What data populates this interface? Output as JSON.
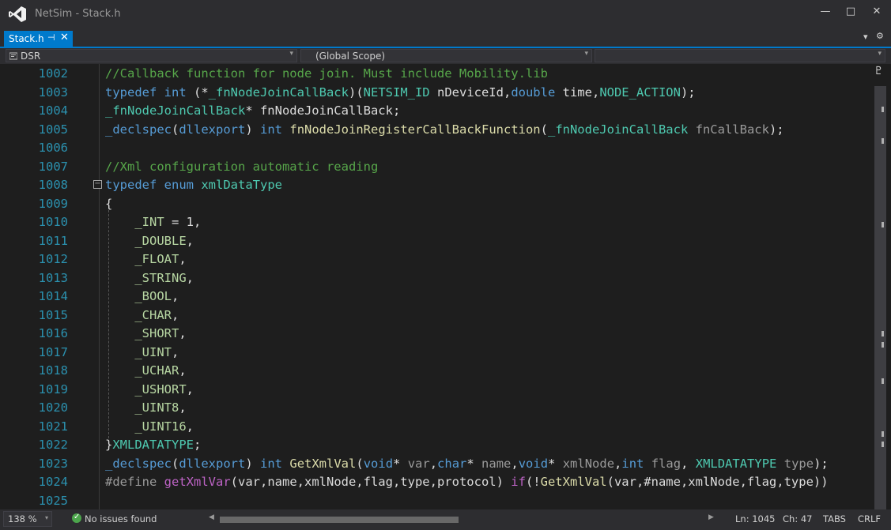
{
  "window": {
    "title": "NetSim - Stack.h",
    "minimize_glyph": "—",
    "maximize_glyph": "□",
    "close_glyph": "✕"
  },
  "tabs": [
    {
      "label": "Stack.h",
      "pin_glyph": "⊣",
      "close_glyph": "✕",
      "active": true
    }
  ],
  "tabrow_icons": {
    "dropdown_glyph": "▾",
    "settings_glyph": "⚙"
  },
  "navbar": {
    "project": "DSR",
    "scope": "(Global Scope)",
    "member": "",
    "arrow_glyph": "▾"
  },
  "editor": {
    "collapse_glyph": "−",
    "lines": [
      {
        "num": "1002",
        "tokens": [
          {
            "t": "//Callback function for node join. Must include Mobility.lib",
            "c": "comment"
          }
        ]
      },
      {
        "num": "1003",
        "tokens": [
          {
            "t": "typedef",
            "c": "kw"
          },
          {
            "t": " ",
            "c": "plain"
          },
          {
            "t": "int",
            "c": "kw"
          },
          {
            "t": " (*",
            "c": "plain"
          },
          {
            "t": "_fnNodeJoinCallBack",
            "c": "type"
          },
          {
            "t": ")(",
            "c": "plain"
          },
          {
            "t": "NETSIM_ID",
            "c": "type"
          },
          {
            "t": " nDeviceId,",
            "c": "plain"
          },
          {
            "t": "double",
            "c": "kw"
          },
          {
            "t": " time,",
            "c": "plain"
          },
          {
            "t": "NODE_ACTION",
            "c": "type"
          },
          {
            "t": ");",
            "c": "plain"
          }
        ]
      },
      {
        "num": "1004",
        "tokens": [
          {
            "t": "_fnNodeJoinCallBack",
            "c": "type"
          },
          {
            "t": "* fnNodeJoinCallBack;",
            "c": "plain"
          }
        ]
      },
      {
        "num": "1005",
        "tokens": [
          {
            "t": "_declspec",
            "c": "kw"
          },
          {
            "t": "(",
            "c": "plain"
          },
          {
            "t": "dllexport",
            "c": "kw"
          },
          {
            "t": ") ",
            "c": "plain"
          },
          {
            "t": "int",
            "c": "kw"
          },
          {
            "t": " ",
            "c": "plain"
          },
          {
            "t": "fnNodeJoinRegisterCallBackFunction",
            "c": "func"
          },
          {
            "t": "(",
            "c": "plain"
          },
          {
            "t": "_fnNodeJoinCallBack",
            "c": "type"
          },
          {
            "t": " ",
            "c": "plain"
          },
          {
            "t": "fnCallBack",
            "c": "param"
          },
          {
            "t": ");",
            "c": "plain"
          }
        ]
      },
      {
        "num": "1006",
        "tokens": []
      },
      {
        "num": "1007",
        "tokens": [
          {
            "t": "//Xml configuration automatic reading",
            "c": "comment"
          }
        ]
      },
      {
        "num": "1008",
        "tokens": [
          {
            "t": "typedef",
            "c": "kw"
          },
          {
            "t": " ",
            "c": "plain"
          },
          {
            "t": "enum",
            "c": "kw"
          },
          {
            "t": " ",
            "c": "plain"
          },
          {
            "t": "xmlDataType",
            "c": "type"
          }
        ]
      },
      {
        "num": "1009",
        "tokens": [
          {
            "t": "{",
            "c": "plain"
          }
        ]
      },
      {
        "num": "1010",
        "tokens": [
          {
            "t": "    ",
            "c": "plain"
          },
          {
            "t": "_INT",
            "c": "enum"
          },
          {
            "t": " = 1,",
            "c": "plain"
          }
        ]
      },
      {
        "num": "1011",
        "tokens": [
          {
            "t": "    ",
            "c": "plain"
          },
          {
            "t": "_DOUBLE",
            "c": "enum"
          },
          {
            "t": ",",
            "c": "plain"
          }
        ]
      },
      {
        "num": "1012",
        "tokens": [
          {
            "t": "    ",
            "c": "plain"
          },
          {
            "t": "_FLOAT",
            "c": "enum"
          },
          {
            "t": ",",
            "c": "plain"
          }
        ]
      },
      {
        "num": "1013",
        "tokens": [
          {
            "t": "    ",
            "c": "plain"
          },
          {
            "t": "_STRING",
            "c": "enum"
          },
          {
            "t": ",",
            "c": "plain"
          }
        ]
      },
      {
        "num": "1014",
        "tokens": [
          {
            "t": "    ",
            "c": "plain"
          },
          {
            "t": "_BOOL",
            "c": "enum"
          },
          {
            "t": ",",
            "c": "plain"
          }
        ]
      },
      {
        "num": "1015",
        "tokens": [
          {
            "t": "    ",
            "c": "plain"
          },
          {
            "t": "_CHAR",
            "c": "enum"
          },
          {
            "t": ",",
            "c": "plain"
          }
        ]
      },
      {
        "num": "1016",
        "tokens": [
          {
            "t": "    ",
            "c": "plain"
          },
          {
            "t": "_SHORT",
            "c": "enum"
          },
          {
            "t": ",",
            "c": "plain"
          }
        ]
      },
      {
        "num": "1017",
        "tokens": [
          {
            "t": "    ",
            "c": "plain"
          },
          {
            "t": "_UINT",
            "c": "enum"
          },
          {
            "t": ",",
            "c": "plain"
          }
        ]
      },
      {
        "num": "1018",
        "tokens": [
          {
            "t": "    ",
            "c": "plain"
          },
          {
            "t": "_UCHAR",
            "c": "enum"
          },
          {
            "t": ",",
            "c": "plain"
          }
        ]
      },
      {
        "num": "1019",
        "tokens": [
          {
            "t": "    ",
            "c": "plain"
          },
          {
            "t": "_USHORT",
            "c": "enum"
          },
          {
            "t": ",",
            "c": "plain"
          }
        ]
      },
      {
        "num": "1020",
        "tokens": [
          {
            "t": "    ",
            "c": "plain"
          },
          {
            "t": "_UINT8",
            "c": "enum"
          },
          {
            "t": ",",
            "c": "plain"
          }
        ]
      },
      {
        "num": "1021",
        "tokens": [
          {
            "t": "    ",
            "c": "plain"
          },
          {
            "t": "_UINT16",
            "c": "enum"
          },
          {
            "t": ",",
            "c": "plain"
          }
        ]
      },
      {
        "num": "1022",
        "tokens": [
          {
            "t": "}",
            "c": "plain"
          },
          {
            "t": "XMLDATATYPE",
            "c": "type"
          },
          {
            "t": ";",
            "c": "plain"
          }
        ]
      },
      {
        "num": "1023",
        "tokens": [
          {
            "t": "_declspec",
            "c": "kw"
          },
          {
            "t": "(",
            "c": "plain"
          },
          {
            "t": "dllexport",
            "c": "kw"
          },
          {
            "t": ") ",
            "c": "plain"
          },
          {
            "t": "int",
            "c": "kw"
          },
          {
            "t": " ",
            "c": "plain"
          },
          {
            "t": "GetXmlVal",
            "c": "func"
          },
          {
            "t": "(",
            "c": "plain"
          },
          {
            "t": "void",
            "c": "kw"
          },
          {
            "t": "* ",
            "c": "plain"
          },
          {
            "t": "var",
            "c": "param"
          },
          {
            "t": ",",
            "c": "plain"
          },
          {
            "t": "char",
            "c": "kw"
          },
          {
            "t": "* ",
            "c": "plain"
          },
          {
            "t": "name",
            "c": "param"
          },
          {
            "t": ",",
            "c": "plain"
          },
          {
            "t": "void",
            "c": "kw"
          },
          {
            "t": "* ",
            "c": "plain"
          },
          {
            "t": "xmlNode",
            "c": "param"
          },
          {
            "t": ",",
            "c": "plain"
          },
          {
            "t": "int",
            "c": "kw"
          },
          {
            "t": " ",
            "c": "plain"
          },
          {
            "t": "flag",
            "c": "param"
          },
          {
            "t": ", ",
            "c": "plain"
          },
          {
            "t": "XMLDATATYPE",
            "c": "type"
          },
          {
            "t": " ",
            "c": "plain"
          },
          {
            "t": "type",
            "c": "param"
          },
          {
            "t": ");",
            "c": "plain"
          }
        ]
      },
      {
        "num": "1024",
        "tokens": [
          {
            "t": "#define",
            "c": "pre"
          },
          {
            "t": " ",
            "c": "plain"
          },
          {
            "t": "getXmlVar",
            "c": "macro"
          },
          {
            "t": "(var,name,xmlNode,flag,type,protocol) ",
            "c": "plain"
          },
          {
            "t": "if",
            "c": "macro"
          },
          {
            "t": "(!",
            "c": "plain"
          },
          {
            "t": "GetXmlVal",
            "c": "func"
          },
          {
            "t": "(var,#name,xmlNode,flag,type))",
            "c": "plain"
          }
        ]
      },
      {
        "num": "1025",
        "tokens": []
      }
    ]
  },
  "scrollbar": {
    "split_glyph": "♇"
  },
  "statusbar": {
    "zoom": "138 %",
    "zoom_arrow_glyph": "▾",
    "issues": "No issues found",
    "ok_glyph": "✓",
    "scroll_left_glyph": "◀",
    "scroll_right_glyph": "▶",
    "ln": "Ln: 1045",
    "ch": "Ch: 47",
    "tabs": "TABS",
    "eol": "CRLF"
  },
  "colors": {
    "accent": "#007acc",
    "comment": "#57a64a",
    "keyword": "#569cd6",
    "type": "#4ec9b0",
    "line_number": "#2b91af"
  }
}
